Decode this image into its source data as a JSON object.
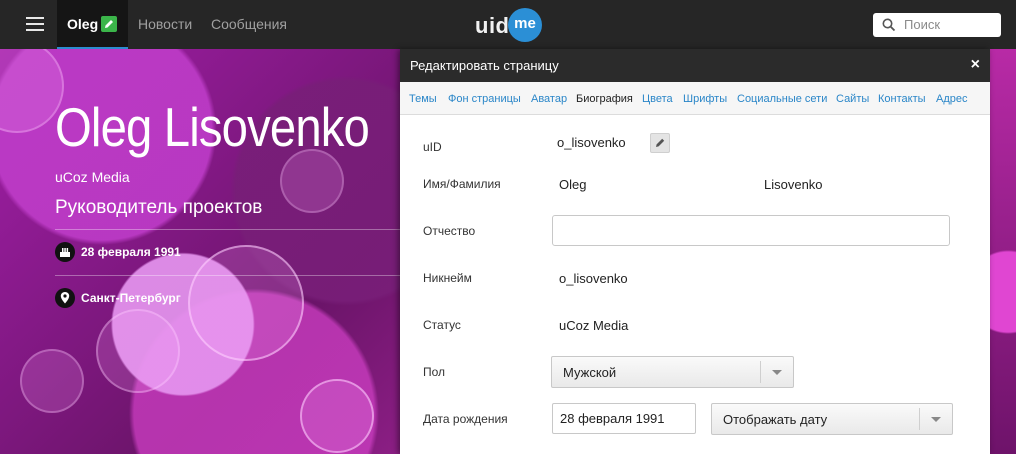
{
  "topbar": {
    "user_name": "Oleg",
    "nav": [
      "Новости",
      "Сообщения"
    ],
    "logo": {
      "left": "uid",
      "right": "me"
    },
    "search_placeholder": "Поиск"
  },
  "profile": {
    "name": "Oleg Lisovenko",
    "company": "uCoz Media",
    "position": "Руководитель проектов",
    "birthday": "28 февраля 1991",
    "city": "Санкт-Петербург"
  },
  "dialog": {
    "title": "Редактировать страницу",
    "close": "×",
    "tabs": [
      "Темы",
      "Фон страницы",
      "Аватар",
      "Биография",
      "Цвета",
      "Шрифты",
      "Социальные сети",
      "Сайты",
      "Контакты",
      "Адрес"
    ],
    "active_tab": "Биография",
    "fields": {
      "uid_label": "uID",
      "uid_value": "o_lisovenko",
      "fullname_label": "Имя/Фамилия",
      "first_name": "Oleg",
      "last_name": "Lisovenko",
      "patronymic_label": "Отчество",
      "patronymic_value": "",
      "nickname_label": "Никнейм",
      "nickname_value": "o_lisovenko",
      "status_label": "Статус",
      "status_value": "uCoz Media",
      "gender_label": "Пол",
      "gender_value": "Мужской",
      "birthdate_label": "Дата рождения",
      "birthdate_value": "28 февраля 1991",
      "birthdate_display": "Отображать дату"
    }
  },
  "colors": {
    "accent": "#2c8ccf",
    "edit_badge": "#3bb54a",
    "link": "#2a86c8",
    "topbar": "#262626"
  }
}
